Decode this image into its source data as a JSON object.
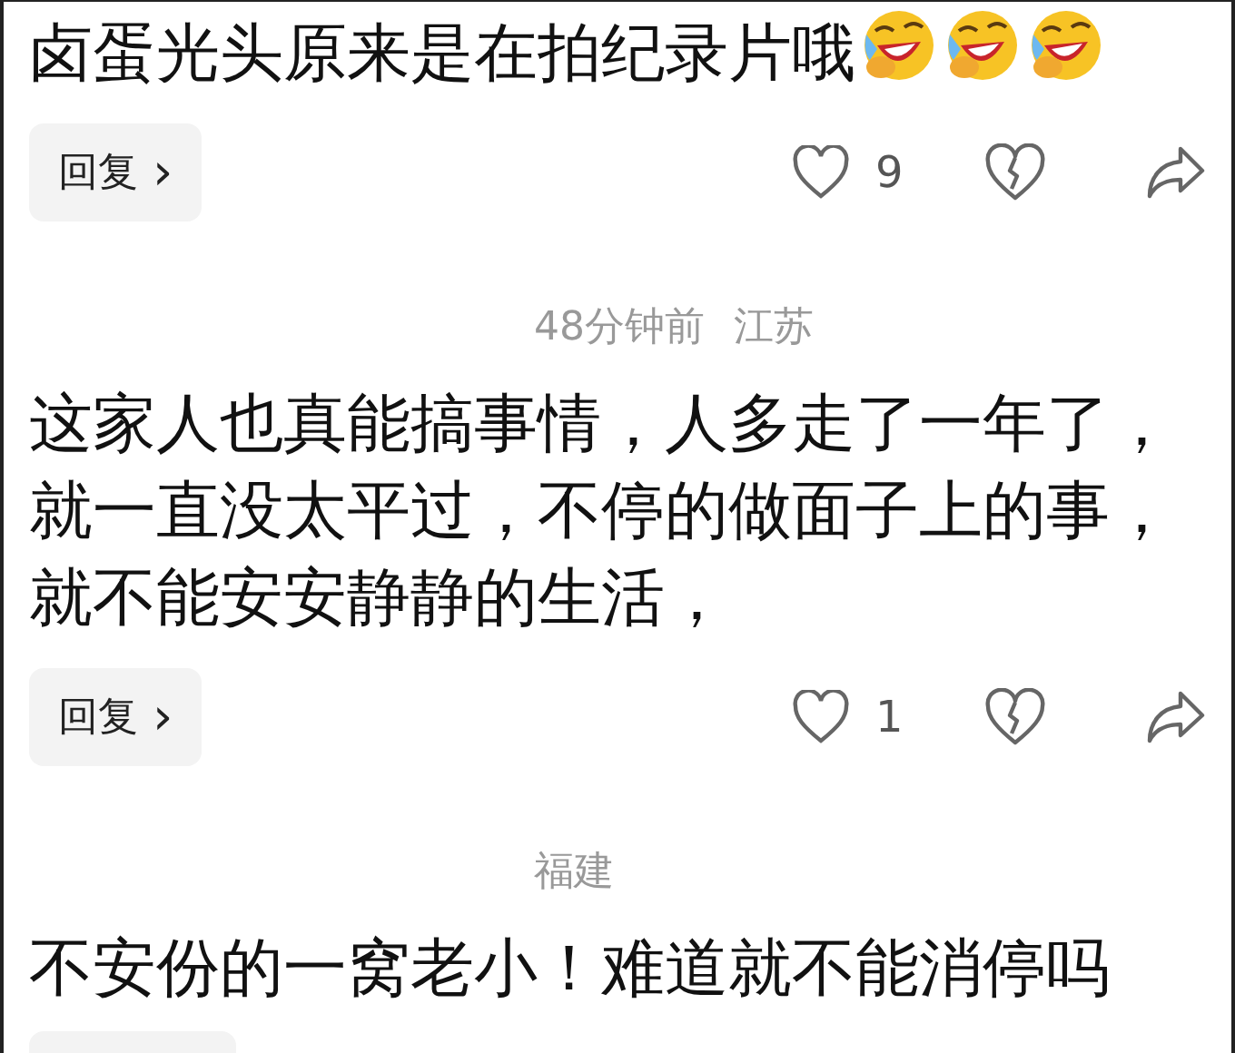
{
  "comments": [
    {
      "text": "卤蛋光头原来是在拍纪录片哦",
      "emojis": [
        {
          "kind": "laughing-crying"
        },
        {
          "kind": "laughing-crying"
        },
        {
          "kind": "laughing-crying"
        }
      ],
      "reply": "回复",
      "chevron": "›",
      "likes": "9"
    },
    {
      "time": "48分钟前",
      "location": "江苏",
      "text": "这家人也真能搞事情，人多走了一年了，就一直没太平过，不停的做面子上的事，就不能安安静静的生活，",
      "reply": "回复",
      "chevron": "›",
      "likes": "1"
    },
    {
      "location": "福建",
      "text": "不安份的一窝老小！难道就不能消停吗"
    }
  ]
}
